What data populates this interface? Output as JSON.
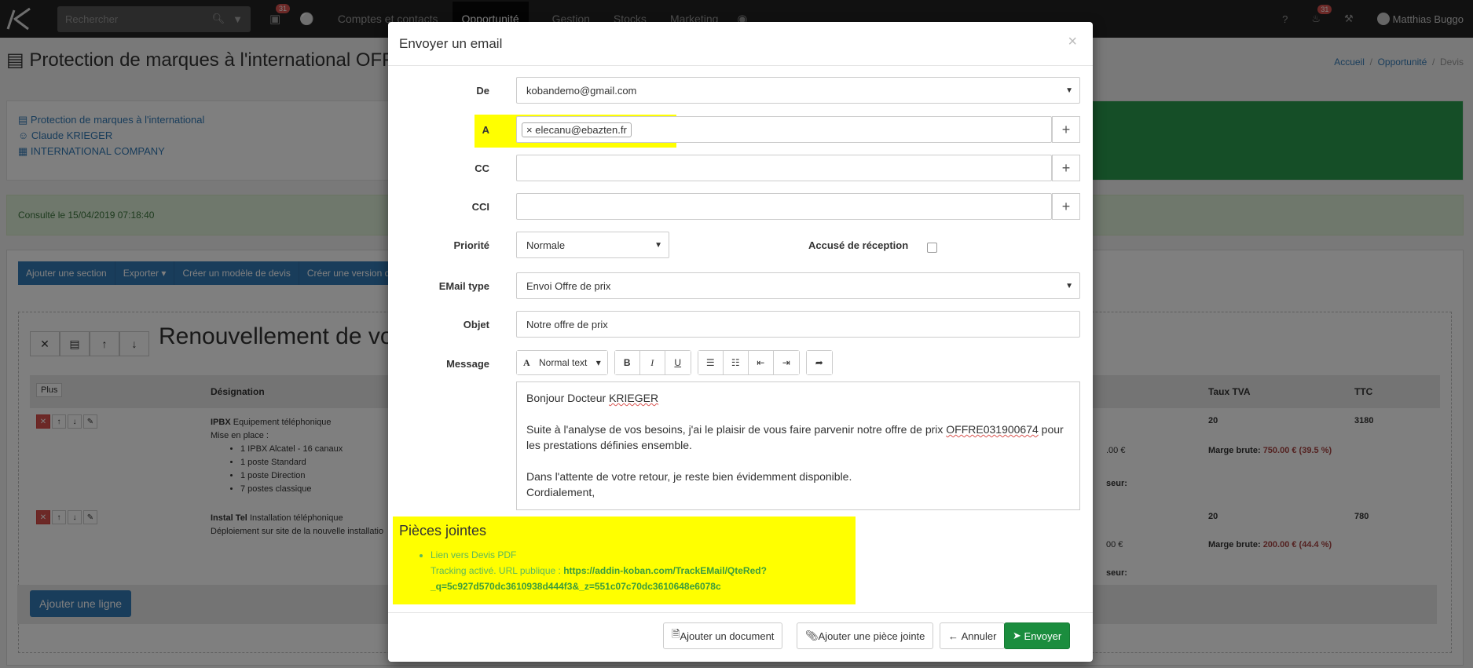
{
  "navbar": {
    "search_placeholder": "Rechercher",
    "phone_badge": "31",
    "menu": [
      "Comptes et contacts",
      "Opportunité",
      "Gestion",
      "Stocks",
      "Marketing"
    ],
    "notif_badge": "31",
    "user_name": "Matthias Buggo"
  },
  "page": {
    "title": "Protection de marques à l'international OFFRE",
    "breadcrumb": [
      "Accueil",
      "Opportunité",
      "Devis"
    ],
    "info_links": [
      "Protection de marques à l'international",
      "Claude KRIEGER",
      "INTERNATIONAL COMPANY"
    ],
    "consulted": "Consulté le 15/04/2019 07:18:40",
    "toolbar": [
      "Ajouter une section",
      "Exporter ▾",
      "Créer un modèle de devis",
      "Créer une version de dev"
    ],
    "section_title": "Renouvellement de votr",
    "plus_label": "Plus",
    "headers": {
      "designation": "Désignation",
      "tva": "Taux TVA",
      "ttc": "TTC"
    },
    "rows": [
      {
        "name": "IPBX",
        "label": "Equipement téléphonique",
        "intro": "Mise en place :",
        "items": [
          "1 IPBX Alcatel - 16 canaux",
          "1 poste Standard",
          "1 poste Direction",
          "7 postes classique"
        ],
        "tva": "20",
        "ttc": "3180",
        "amount": ".00 €",
        "marge_label": "Marge brute:",
        "marge_value": "750.00 € (39.5 %)",
        "seur": "seur:"
      },
      {
        "name": "Instal Tel",
        "label": "Installation téléphonique",
        "intro": "Déploiement sur site de la nouvelle installatio",
        "items": [],
        "tva": "20",
        "ttc": "780",
        "amount": "00 €",
        "marge_label": "Marge brute:",
        "marge_value": "200.00 € (44.4 %)",
        "seur": "seur:"
      }
    ],
    "add_line": "Ajouter une ligne"
  },
  "modal": {
    "title": "Envoyer un email",
    "from_label": "De",
    "from_value": "kobandemo@gmail.com",
    "to_label": "A",
    "to_tag": "elecanu@ebazten.fr",
    "cc_label": "CC",
    "bcc_label": "CCI",
    "priority_label": "Priorité",
    "priority_value": "Normale",
    "receipt_label": "Accusé de réception",
    "type_label": "EMail type",
    "type_value": "Envoi Offre de prix",
    "subject_label": "Objet",
    "subject_value": "Notre offre de prix",
    "message_label": "Message",
    "editor_style": "Normal text",
    "message": {
      "greeting_prefix": "Bonjour Docteur ",
      "greeting_name": "KRIEGER",
      "p1_prefix": "Suite à l'analyse de vos besoins, j'ai le plaisir de vous faire parvenir notre offre de prix ",
      "p1_ref": "OFFRE031900674",
      "p1_suffix": " pour",
      "p1_line2": "les prestations définies ensemble.",
      "p2": "Dans l'attente de votre retour, je reste bien évidemment disponible.",
      "p3": "Cordialement,"
    },
    "attachments_title": "Pièces jointes",
    "attachment_link": "Lien vers Devis PDF",
    "tracking_prefix": "Tracking activé. URL publique : ",
    "tracking_url_1": "https://addin-koban.com/TrackEMail/QteRed?",
    "tracking_url_2": "_q=5c927d570dc3610938d444f3&_z=551c07c70dc3610648e6078c",
    "buttons": {
      "add_document": "Ajouter un document",
      "add_attachment": "Ajouter une pièce jointe",
      "cancel": "Annuler",
      "send": "Envoyer"
    }
  }
}
